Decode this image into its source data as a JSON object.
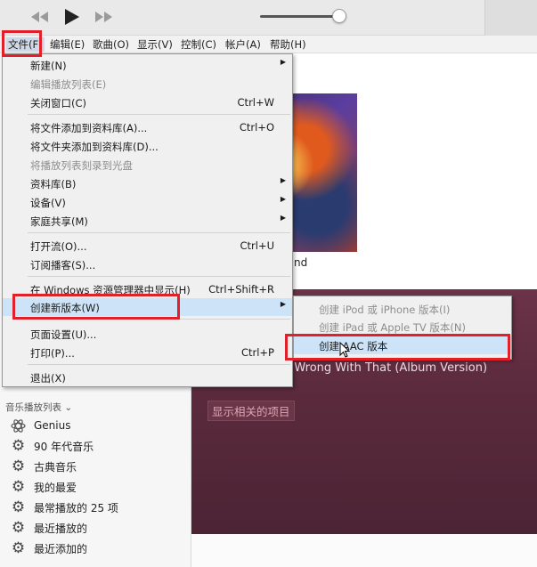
{
  "menubar": {
    "items": [
      "文件(F)",
      "编辑(E)",
      "歌曲(O)",
      "显示(V)",
      "控制(C)",
      "帐户(A)",
      "帮助(H)"
    ]
  },
  "file_menu": {
    "new": {
      "label": "新建(N)"
    },
    "edit_playlist": {
      "label": "编辑播放列表(E)"
    },
    "close_window": {
      "label": "关闭窗口(C)",
      "shortcut": "Ctrl+W"
    },
    "add_file": {
      "label": "将文件添加到资料库(A)...",
      "shortcut": "Ctrl+O"
    },
    "add_folder": {
      "label": "将文件夹添加到资料库(D)..."
    },
    "burn_playlist": {
      "label": "将播放列表刻录到光盘"
    },
    "library": {
      "label": "资料库(B)"
    },
    "devices": {
      "label": "设备(V)"
    },
    "home_sharing": {
      "label": "家庭共享(M)"
    },
    "open_stream": {
      "label": "打开流(O)...",
      "shortcut": "Ctrl+U"
    },
    "subscribe_podcast": {
      "label": "订阅播客(S)..."
    },
    "show_in_explorer": {
      "label": "在 Windows 资源管理器中显示(H)",
      "shortcut": "Ctrl+Shift+R"
    },
    "create_new_version": {
      "label": "创建新版本(W)"
    },
    "page_setup": {
      "label": "页面设置(U)..."
    },
    "print": {
      "label": "打印(P)...",
      "shortcut": "Ctrl+P"
    },
    "exit": {
      "label": "退出(X)"
    }
  },
  "submenu": {
    "ipod_iphone": "创建 iPod 或 iPhone 版本(I)",
    "ipad_appletv": "创建 iPad 或 Apple TV 版本(N)",
    "aac": "创建 AAC 版本"
  },
  "main": {
    "album_suffix": "nd",
    "song_title": "g Wrong With That (Album Version)",
    "related_button": "显示相关的项目"
  },
  "sidebar": {
    "playlists_header": "音乐播放列表 ⌄",
    "items": [
      {
        "label": "Genius",
        "icon": "genius-icon"
      },
      {
        "label": "90 年代音乐",
        "icon": "gear-icon"
      },
      {
        "label": "古典音乐",
        "icon": "gear-icon"
      },
      {
        "label": "我的最爱",
        "icon": "gear-icon"
      },
      {
        "label": "最常播放的 25 项",
        "icon": "gear-icon"
      },
      {
        "label": "最近播放的",
        "icon": "gear-icon"
      },
      {
        "label": "最近添加的",
        "icon": "gear-icon"
      }
    ]
  },
  "colors": {
    "highlight_box": "#e2202a",
    "menu_hover": "#cde3f7",
    "panel_bg": "#5a2a3c"
  }
}
